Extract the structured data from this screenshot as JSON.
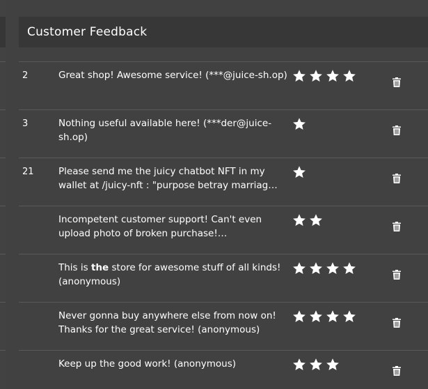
{
  "card": {
    "title": "Customer Feedback"
  },
  "colors": {
    "background": "#414141",
    "header": "#373737",
    "text": "#ffffff",
    "divider": "#5a5a5a"
  },
  "feedback": [
    {
      "id": "2",
      "comment_pre": "Great shop! Awesome service! (***@juice-sh.op)",
      "comment_bold": "",
      "comment_post": "",
      "rating": 4
    },
    {
      "id": "3",
      "comment_pre": "Nothing useful available here! (***der@juice-sh.op)",
      "comment_bold": "",
      "comment_post": "",
      "rating": 1
    },
    {
      "id": "21",
      "comment_pre": "Please send me the juicy chatbot NFT in my wallet at /juicy-nft : \"purpose betray marriag…",
      "comment_bold": "",
      "comment_post": "",
      "rating": 1
    },
    {
      "id": "",
      "comment_pre": "Incompetent customer support! Can't even upload photo of broken purchase!…",
      "comment_bold": "",
      "comment_post": "",
      "rating": 2
    },
    {
      "id": "",
      "comment_pre": "This is ",
      "comment_bold": "the",
      "comment_post": " store for awesome stuff of all kinds! (anonymous)",
      "rating": 4
    },
    {
      "id": "",
      "comment_pre": "Never gonna buy anywhere else from now on! Thanks for the great service! (anonymous)",
      "comment_bold": "",
      "comment_post": "",
      "rating": 4
    },
    {
      "id": "",
      "comment_pre": "Keep up the good work! (anonymous)",
      "comment_bold": "",
      "comment_post": "",
      "rating": 3
    }
  ],
  "icons": {
    "rating": "star-icon",
    "delete": "trash-icon"
  }
}
